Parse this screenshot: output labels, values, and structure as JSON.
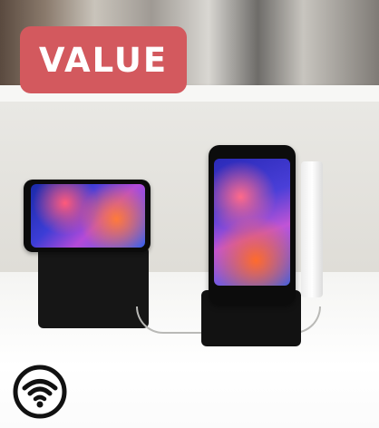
{
  "badge": {
    "label": "VALUE",
    "color": "#d3595e",
    "text_color": "#ffffff"
  },
  "icons": {
    "wireless": "wireless-charging-icon"
  },
  "image": {
    "subject": "product-photo"
  }
}
